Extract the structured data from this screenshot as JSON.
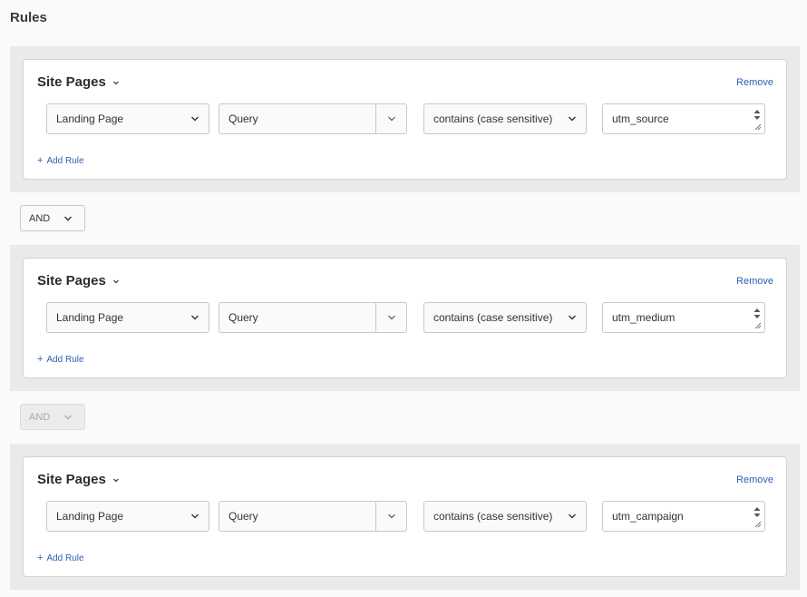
{
  "page": {
    "title": "Rules"
  },
  "groups": [
    {
      "heading": "Site Pages",
      "remove": "Remove",
      "dimension": "Landing Page",
      "attribute": "Query",
      "operator": "contains (case sensitive)",
      "value": "utm_source",
      "add_rule": "Add Rule"
    },
    {
      "heading": "Site Pages",
      "remove": "Remove",
      "dimension": "Landing Page",
      "attribute": "Query",
      "operator": "contains (case sensitive)",
      "value": "utm_medium",
      "add_rule": "Add Rule"
    },
    {
      "heading": "Site Pages",
      "remove": "Remove",
      "dimension": "Landing Page",
      "attribute": "Query",
      "operator": "contains (case sensitive)",
      "value": "utm_campaign",
      "add_rule": "Add Rule"
    }
  ],
  "connectors": [
    {
      "label": "AND",
      "enabled": true
    },
    {
      "label": "AND",
      "enabled": false
    }
  ],
  "colors": {
    "link": "#2d5fb3",
    "band": "#eaeaea",
    "border": "#c8c8c8"
  }
}
